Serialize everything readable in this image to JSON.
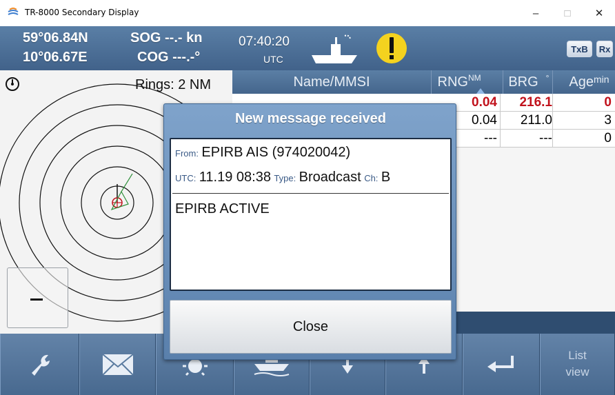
{
  "window": {
    "title": "TR-8000 Secondary Display",
    "app_icon": "ship-wave-icon",
    "controls": {
      "minimize": "–",
      "maximize": "□",
      "close": "✕"
    }
  },
  "header": {
    "latitude": "59°06.84N",
    "longitude": "10°06.67E",
    "sog": "SOG --.- kn",
    "cog": "COG ---.-°",
    "time": "07:40:20",
    "time_zone": "UTC",
    "own_ship_icon": "ship-icon",
    "alert_icon": "warning-icon",
    "status_tags": [
      "TxB",
      "Rx"
    ]
  },
  "radar": {
    "rings_label": "Rings: 2 NM",
    "orientation_icon": "compass-icon",
    "zoom_out_icon": "minus-icon"
  },
  "target_list": {
    "columns": {
      "name": "Name/MMSI",
      "rng": "RNG",
      "rng_unit": "NM",
      "brg": "BRG",
      "brg_unit": "°",
      "age": "Age",
      "age_unit": "min"
    },
    "rows": [
      {
        "rng": "0.04",
        "brg": "216.1",
        "age": "0",
        "alert": true
      },
      {
        "rng": "0.04",
        "brg": "211.0",
        "age": "3",
        "alert": false
      },
      {
        "rng": "---",
        "brg": "---",
        "age": "0",
        "alert": false
      }
    ],
    "alert_color": "#c1121c"
  },
  "toolbar": {
    "buttons": [
      {
        "icon": "wrench-icon"
      },
      {
        "icon": "envelope-icon"
      },
      {
        "icon": "brightness-icon"
      },
      {
        "icon": "ship-icon"
      },
      {
        "icon": "arrow-down-icon"
      },
      {
        "icon": "arrow-up-icon"
      },
      {
        "icon": "enter-icon"
      },
      {
        "icon": "list-view-icon",
        "label_line1": "List",
        "label_line2": "view"
      }
    ]
  },
  "modal": {
    "title": "New message received",
    "from_label": "From:",
    "from_value": "EPIRB AIS (974020042)",
    "utc_label": "UTC:",
    "utc_value": "11.19 08:38",
    "type_label": "Type:",
    "type_value": "Broadcast",
    "ch_label": "Ch:",
    "ch_value": "B",
    "body": "EPIRB ACTIVE",
    "close_label": "Close"
  },
  "colors": {
    "header_blue": "#4d6f97",
    "alert_yellow": "#f4d21f",
    "modal_blue": "#6e93bf"
  }
}
